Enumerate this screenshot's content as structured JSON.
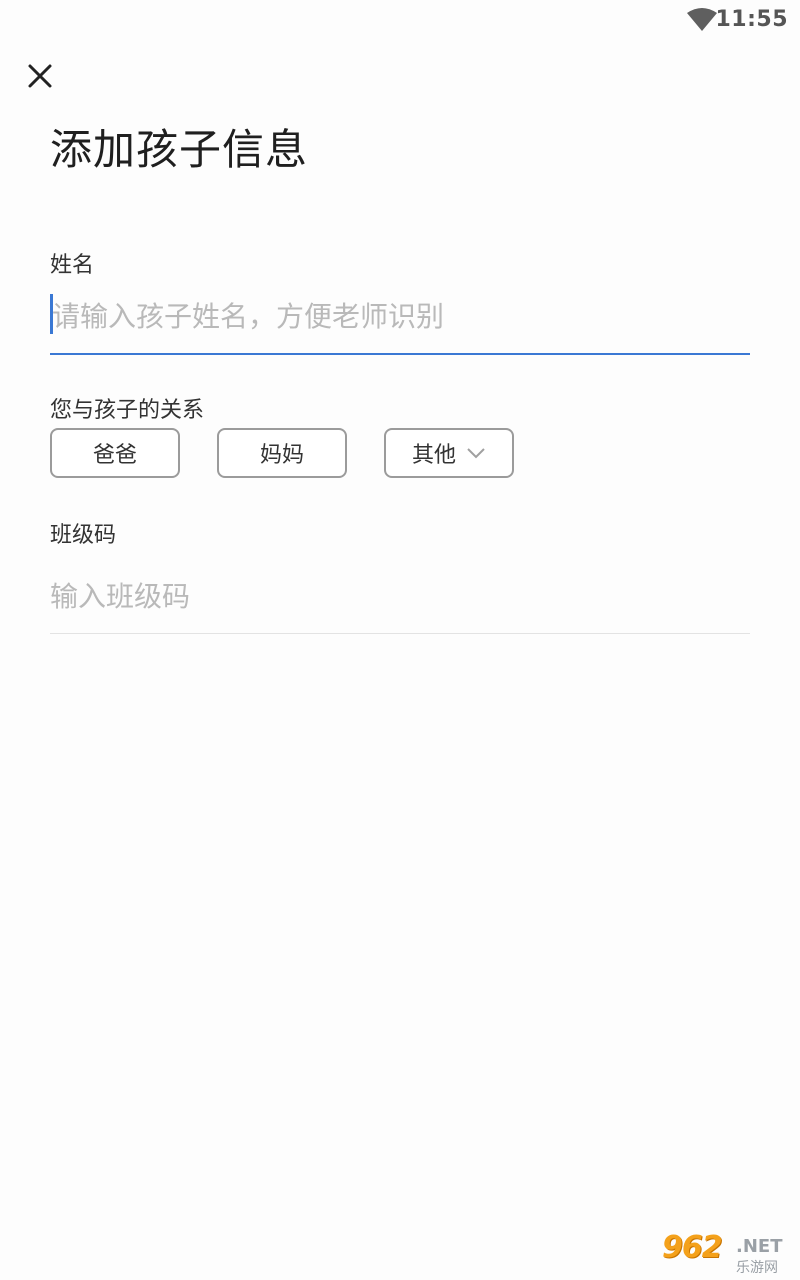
{
  "status_bar": {
    "time": "11:55"
  },
  "header": {
    "title": "添加孩子信息"
  },
  "form": {
    "name": {
      "label": "姓名",
      "placeholder": "请输入孩子姓名，方便老师识别",
      "value": ""
    },
    "relation": {
      "label": "您与孩子的关系",
      "options": [
        "爸爸",
        "妈妈",
        "其他"
      ]
    },
    "class_code": {
      "label": "班级码",
      "placeholder": "输入班级码",
      "value": ""
    }
  },
  "colors": {
    "accent": "#3a78d4",
    "chip_border": "#9b9b9b",
    "placeholder": "#b9b9b9"
  },
  "watermark": {
    "number": "962",
    "net": ".NET",
    "cn": "乐游网"
  }
}
